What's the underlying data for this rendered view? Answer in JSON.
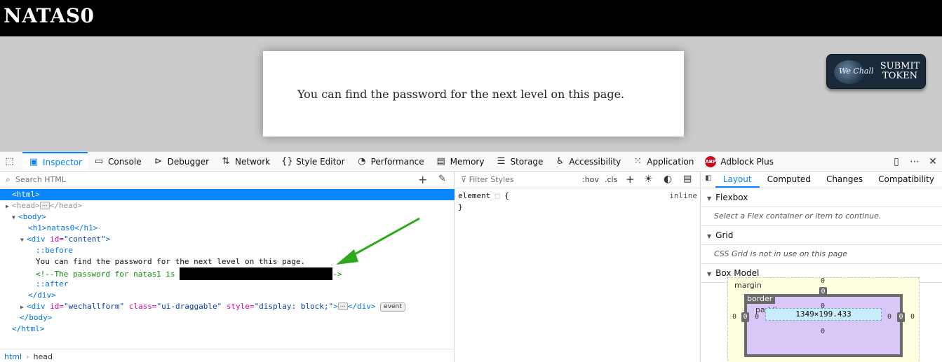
{
  "page": {
    "title": "NATAS0",
    "content_text": "You can find the password for the next level on this page.",
    "wechall_brand": "We Chall",
    "submit_line1": "SUBMIT",
    "submit_line2": "TOKEN"
  },
  "toolbar": {
    "tabs": [
      "Inspector",
      "Console",
      "Debugger",
      "Network",
      "Style Editor",
      "Performance",
      "Memory",
      "Storage",
      "Accessibility",
      "Application",
      "Adblock Plus"
    ],
    "abp_icon": "ABP"
  },
  "markup": {
    "search_placeholder": "Search HTML",
    "lines": {
      "html_open": "<html>",
      "head": "<head>",
      "head_close": "</head>",
      "body_open": "<body>",
      "h1": "<h1>natas0</h1>",
      "div_open_tag": "<div",
      "div_attr_id": "id=",
      "div_val_content": "\"content\"",
      "before": "::before",
      "text_line": "You can find the password for the next level on this page.",
      "comment_start": "<!--The password for natas1 is ",
      "comment_end": "->",
      "after": "::after",
      "div_close": "</div>",
      "class_attr": "class=",
      "style_attr": "style=",
      "wechall_id": "\"wechallform\"",
      "wechall_class": "\"ui-draggable\"",
      "wechall_style": "\"display: block;\"",
      "event_badge": "event",
      "body_close": "</body>",
      "html_close": "</html>",
      "gt": ">"
    },
    "breadcrumbs": [
      "html",
      "head"
    ]
  },
  "rules": {
    "filter_placeholder": "Filter Styles",
    "hov": ":hov",
    "cls": ".cls",
    "selector": "element",
    "open_brace": "{",
    "close_brace": "}",
    "origin": "inline"
  },
  "sidebar": {
    "tabs": [
      "Layout",
      "Computed",
      "Changes",
      "Compatibility"
    ],
    "flexbox_title": "Flexbox",
    "flexbox_msg": "Select a Flex container or item to continue.",
    "grid_title": "Grid",
    "grid_msg": "CSS Grid is not in use on this page",
    "boxmodel_title": "Box Model",
    "boxmodel": {
      "margin_label": "margin",
      "border_label": "border",
      "padding_label": "padding",
      "content_size": "1349×199.433",
      "margin_top": "0",
      "border_top": "0",
      "padding_top": "0",
      "margin_left": "0",
      "border_left": "0",
      "padding_left": "0",
      "margin_right": "0",
      "border_right": "0",
      "padding_right": "0",
      "padding_bottom": "0"
    }
  }
}
